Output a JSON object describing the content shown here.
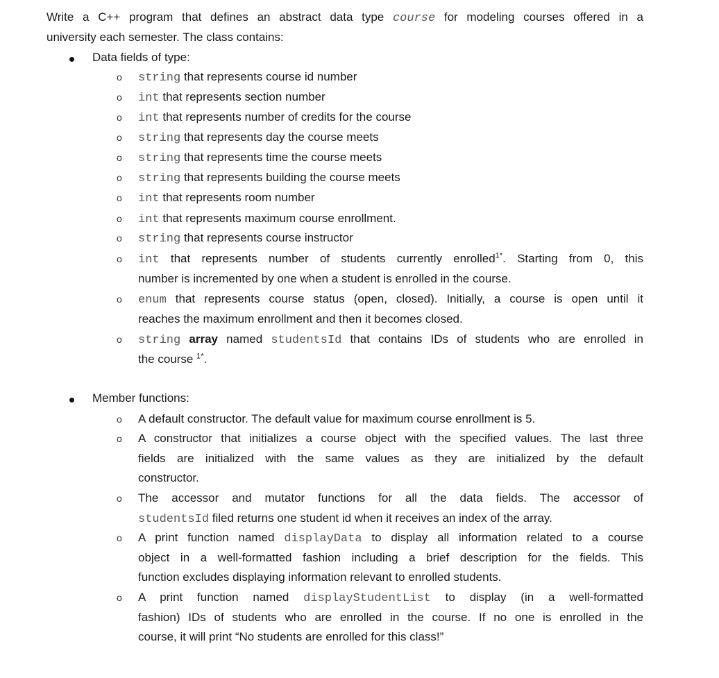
{
  "intro": {
    "part1": "Write a C++ program that defines an abstract data type",
    "type_name": "course",
    "part2": "for modeling courses offered in a",
    "line2": "university each semester. The class contains:"
  },
  "data_fields": {
    "heading": "Data fields of type:",
    "items": [
      {
        "code": "string",
        "text": "that represents course id number"
      },
      {
        "code": "int",
        "text": "that represents section number"
      },
      {
        "code": "int",
        "text": "that represents number of credits for the course"
      },
      {
        "code": "string",
        "text": "that represents day the course meets"
      },
      {
        "code": "string",
        "text": "that represents time the course meets"
      },
      {
        "code": "string",
        "text": "that represents building the course meets"
      },
      {
        "code": "int",
        "text": "that represents room number"
      },
      {
        "code": "int",
        "text": "that represents maximum course enrollment."
      },
      {
        "code": "string",
        "text": "that represents course instructor"
      },
      {
        "code": "int",
        "text": "that represents number of students currently enrolled",
        "sup": "1*",
        "text_after_sup": ". Starting from 0, this",
        "line2": "number is incremented by one when a student is enrolled in the course."
      },
      {
        "code": "enum",
        "text": "that represents course status (open, closed). Initially, a course is open until it",
        "line2": "reaches the maximum enrollment and then it becomes closed."
      },
      {
        "code": "string",
        "bold": "array",
        "text": "named",
        "code2": "studentsId",
        "text2": "that contains IDs of students who are enrolled in",
        "line2": "the course",
        "sup": "1*",
        "line2_after": "."
      }
    ]
  },
  "member_functions": {
    "heading": "Member functions:",
    "items": [
      {
        "line1": "A default constructor. The default value for maximum course enrollment is 5."
      },
      {
        "line1": "A constructor that initializes a course object with the specified values. The last three",
        "line2": "fields are initialized with the same values as they are initialized by the default",
        "line3": "constructor."
      },
      {
        "line1": "The accessor and mutator functions for all the data fields. The accessor of",
        "line2_code": "studentsId",
        "line2": "filed returns one student id when it receives an index of the array."
      },
      {
        "line1_pre": "A print function named",
        "line1_code": "displayData",
        "line1_post": "to display all information related to a course",
        "line2": "object in a well-formatted fashion including a brief description for the fields. This",
        "line3": "function excludes displaying information relevant to enrolled students."
      },
      {
        "line1_pre": "A print function named",
        "line1_code": "displayStudentList",
        "line1_post": "to display (in a well-formatted",
        "line2": "fashion) IDs of students who are enrolled in the course. If no one is enrolled in the",
        "line3": "course, it will print “No students are enrolled for this class!”"
      }
    ]
  }
}
